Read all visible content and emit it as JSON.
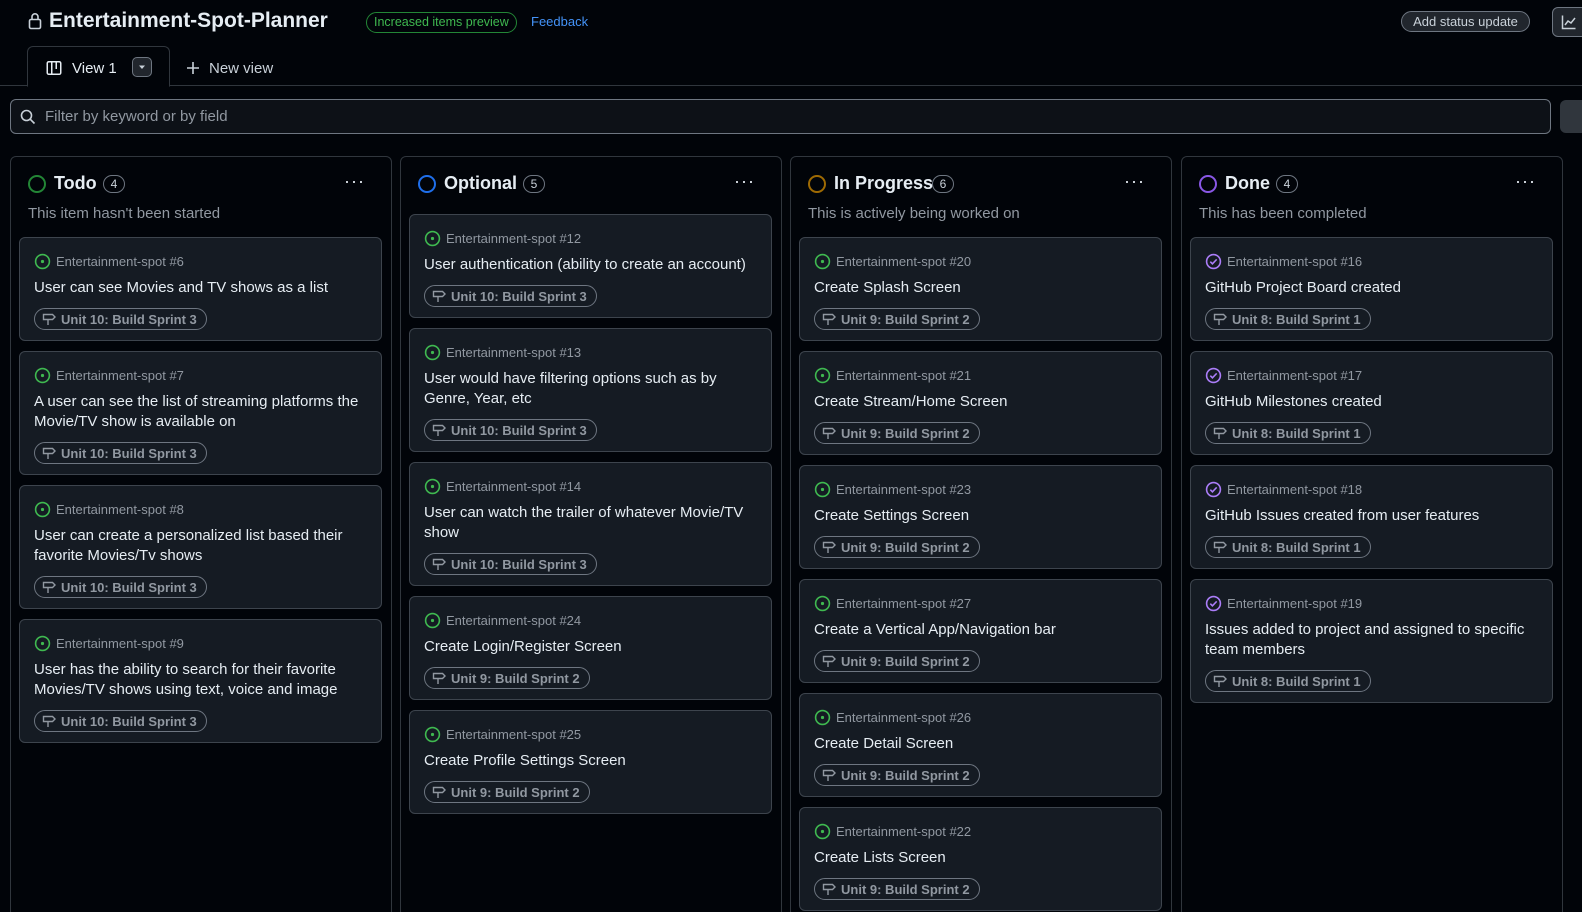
{
  "header": {
    "title": "Entertainment-Spot-Planner",
    "preview_badge": "Increased items preview",
    "feedback": "Feedback",
    "status_button": "Add status update"
  },
  "tabs": {
    "active_label": "View 1",
    "new_view_label": "New view"
  },
  "filter": {
    "placeholder": "Filter by keyword or by field"
  },
  "colors": {
    "todo": "#238636",
    "optional": "#1f6feb",
    "in_progress": "#9e6a03",
    "done": "#8957e5",
    "open_issue": "#3fb950",
    "closed_issue": "#ab7df8"
  },
  "columns": [
    {
      "name": "Todo",
      "count": "4",
      "description": "This item hasn't been started",
      "cards": [
        {
          "ref": "Entertainment-spot #6",
          "title": "User can see Movies and TV shows as a list",
          "milestone": "Unit 10: Build Sprint 3"
        },
        {
          "ref": "Entertainment-spot #7",
          "title": "A user can see the list of streaming platforms the Movie/TV show is available on",
          "milestone": "Unit 10: Build Sprint 3"
        },
        {
          "ref": "Entertainment-spot #8",
          "title": "User can create a personalized list based their favorite Movies/Tv shows",
          "milestone": "Unit 10: Build Sprint 3"
        },
        {
          "ref": "Entertainment-spot #9",
          "title": "User has the ability to search for their favorite Movies/TV shows using text, voice and image",
          "milestone": "Unit 10: Build Sprint 3"
        }
      ]
    },
    {
      "name": "Optional",
      "count": "5",
      "description": "",
      "cards": [
        {
          "ref": "Entertainment-spot #12",
          "title": "User authentication (ability to create an account)",
          "milestone": "Unit 10: Build Sprint 3"
        },
        {
          "ref": "Entertainment-spot #13",
          "title": "User would have filtering options such as by Genre, Year, etc",
          "milestone": "Unit 10: Build Sprint 3"
        },
        {
          "ref": "Entertainment-spot #14",
          "title": "User can watch the trailer of whatever Movie/TV show",
          "milestone": "Unit 10: Build Sprint 3"
        },
        {
          "ref": "Entertainment-spot #24",
          "title": "Create Login/Register Screen",
          "milestone": "Unit 9: Build Sprint 2"
        },
        {
          "ref": "Entertainment-spot #25",
          "title": "Create Profile Settings Screen",
          "milestone": "Unit 9: Build Sprint 2"
        }
      ]
    },
    {
      "name": "In Progress",
      "count": "6",
      "description": "This is actively being worked on",
      "cards": [
        {
          "ref": "Entertainment-spot #20",
          "title": "Create Splash Screen",
          "milestone": "Unit 9: Build Sprint 2"
        },
        {
          "ref": "Entertainment-spot #21",
          "title": "Create Stream/Home Screen",
          "milestone": "Unit 9: Build Sprint 2"
        },
        {
          "ref": "Entertainment-spot #23",
          "title": "Create Settings Screen",
          "milestone": "Unit 9: Build Sprint 2"
        },
        {
          "ref": "Entertainment-spot #27",
          "title": "Create a Vertical App/Navigation bar",
          "milestone": "Unit 9: Build Sprint 2"
        },
        {
          "ref": "Entertainment-spot #26",
          "title": "Create Detail Screen",
          "milestone": "Unit 9: Build Sprint 2"
        },
        {
          "ref": "Entertainment-spot #22",
          "title": "Create Lists Screen",
          "milestone": "Unit 9: Build Sprint 2"
        }
      ]
    },
    {
      "name": "Done",
      "count": "4",
      "description": "This has been completed",
      "cards": [
        {
          "ref": "Entertainment-spot #16",
          "title": "GitHub Project Board created",
          "milestone": "Unit 8: Build Sprint 1"
        },
        {
          "ref": "Entertainment-spot #17",
          "title": "GitHub Milestones created",
          "milestone": "Unit 8: Build Sprint 1"
        },
        {
          "ref": "Entertainment-spot #18",
          "title": "GitHub Issues created from user features",
          "milestone": "Unit 8: Build Sprint 1"
        },
        {
          "ref": "Entertainment-spot #19",
          "title": "Issues added to project and assigned to specific team members",
          "milestone": "Unit 8: Build Sprint 1"
        }
      ]
    }
  ]
}
